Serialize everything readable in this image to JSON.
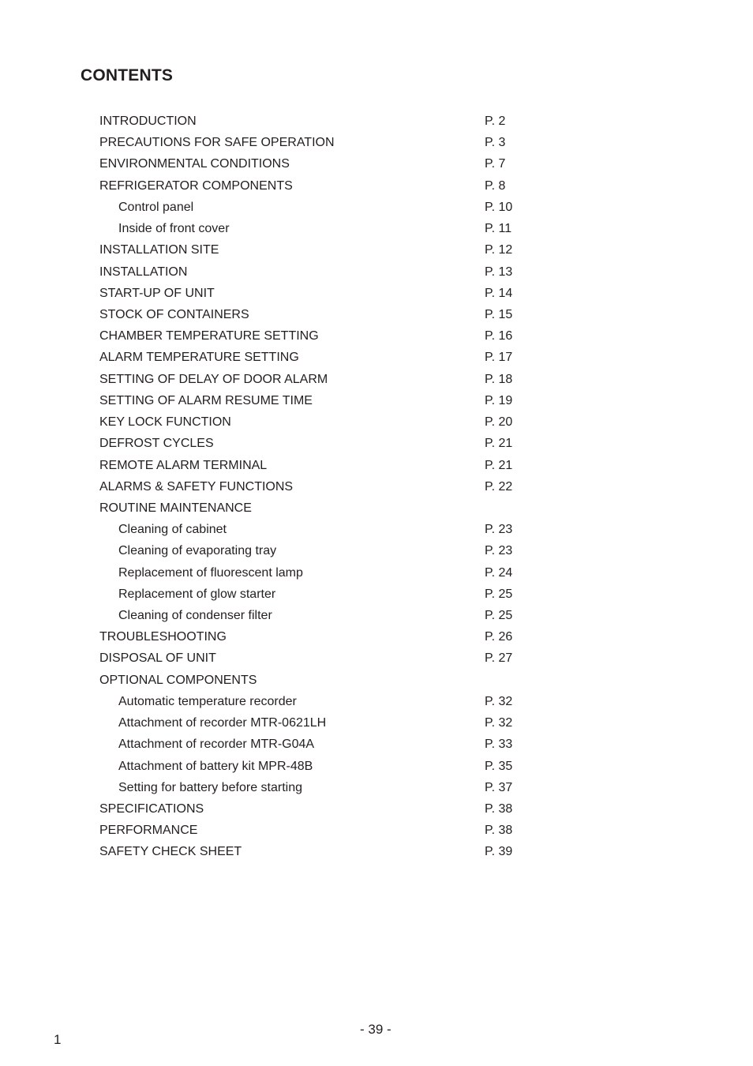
{
  "document": {
    "title": "CONTENTS",
    "footer_page": "- 39 -",
    "corner_number": "1"
  },
  "toc": [
    {
      "label": "INTRODUCTION",
      "page": "P. 2",
      "level": 1
    },
    {
      "label": "PRECAUTIONS FOR SAFE OPERATION",
      "page": "P. 3",
      "level": 1
    },
    {
      "label": "ENVIRONMENTAL CONDITIONS",
      "page": "P. 7",
      "level": 1
    },
    {
      "label": "REFRIGERATOR COMPONENTS",
      "page": "P. 8",
      "level": 1
    },
    {
      "label": "Control panel",
      "page": "P. 10",
      "level": 2
    },
    {
      "label": "Inside of front cover",
      "page": "P. 11",
      "level": 2
    },
    {
      "label": "INSTALLATION SITE",
      "page": "P. 12",
      "level": 1
    },
    {
      "label": "INSTALLATION",
      "page": "P. 13",
      "level": 1
    },
    {
      "label": "START-UP OF UNIT",
      "page": "P. 14",
      "level": 1
    },
    {
      "label": "STOCK OF CONTAINERS",
      "page": "P. 15",
      "level": 1
    },
    {
      "label": "CHAMBER TEMPERATURE SETTING",
      "page": "P. 16",
      "level": 1
    },
    {
      "label": "ALARM TEMPERATURE SETTING",
      "page": "P. 17",
      "level": 1
    },
    {
      "label": "SETTING OF DELAY OF DOOR ALARM",
      "page": "P. 18",
      "level": 1
    },
    {
      "label": "SETTING OF ALARM RESUME TIME",
      "page": "P. 19",
      "level": 1
    },
    {
      "label": "KEY LOCK FUNCTION",
      "page": "P. 20",
      "level": 1
    },
    {
      "label": "DEFROST CYCLES",
      "page": "P. 21",
      "level": 1
    },
    {
      "label": "REMOTE ALARM TERMINAL",
      "page": "P. 21",
      "level": 1
    },
    {
      "label": "ALARMS & SAFETY FUNCTIONS",
      "page": "P. 22",
      "level": 1
    },
    {
      "label": "ROUTINE MAINTENANCE",
      "page": "",
      "level": 1
    },
    {
      "label": "Cleaning of cabinet",
      "page": "P. 23",
      "level": 2
    },
    {
      "label": "Cleaning of evaporating tray",
      "page": "P. 23",
      "level": 2
    },
    {
      "label": "Replacement of fluorescent lamp",
      "page": "P. 24",
      "level": 2
    },
    {
      "label": "Replacement of glow starter",
      "page": "P. 25",
      "level": 2
    },
    {
      "label": "Cleaning of condenser filter",
      "page": "P. 25",
      "level": 2
    },
    {
      "label": "TROUBLESHOOTING",
      "page": "P. 26",
      "level": 1
    },
    {
      "label": "DISPOSAL OF UNIT",
      "page": "P. 27",
      "level": 1
    },
    {
      "label": "OPTIONAL COMPONENTS",
      "page": "",
      "level": 1
    },
    {
      "label": "Automatic temperature recorder",
      "page": "P. 32",
      "level": 2
    },
    {
      "label": "Attachment of recorder MTR-0621LH",
      "page": "P. 32",
      "level": 2
    },
    {
      "label": "Attachment of recorder MTR-G04A",
      "page": "P. 33",
      "level": 2
    },
    {
      "label": "Attachment of battery kit MPR-48B",
      "page": "P. 35",
      "level": 2
    },
    {
      "label": "Setting for battery before starting",
      "page": "P. 37",
      "level": 2
    },
    {
      "label": "SPECIFICATIONS",
      "page": "P. 38",
      "level": 1
    },
    {
      "label": "PERFORMANCE",
      "page": "P. 38",
      "level": 1
    },
    {
      "label": "SAFETY CHECK SHEET",
      "page": "P. 39",
      "level": 1
    }
  ]
}
